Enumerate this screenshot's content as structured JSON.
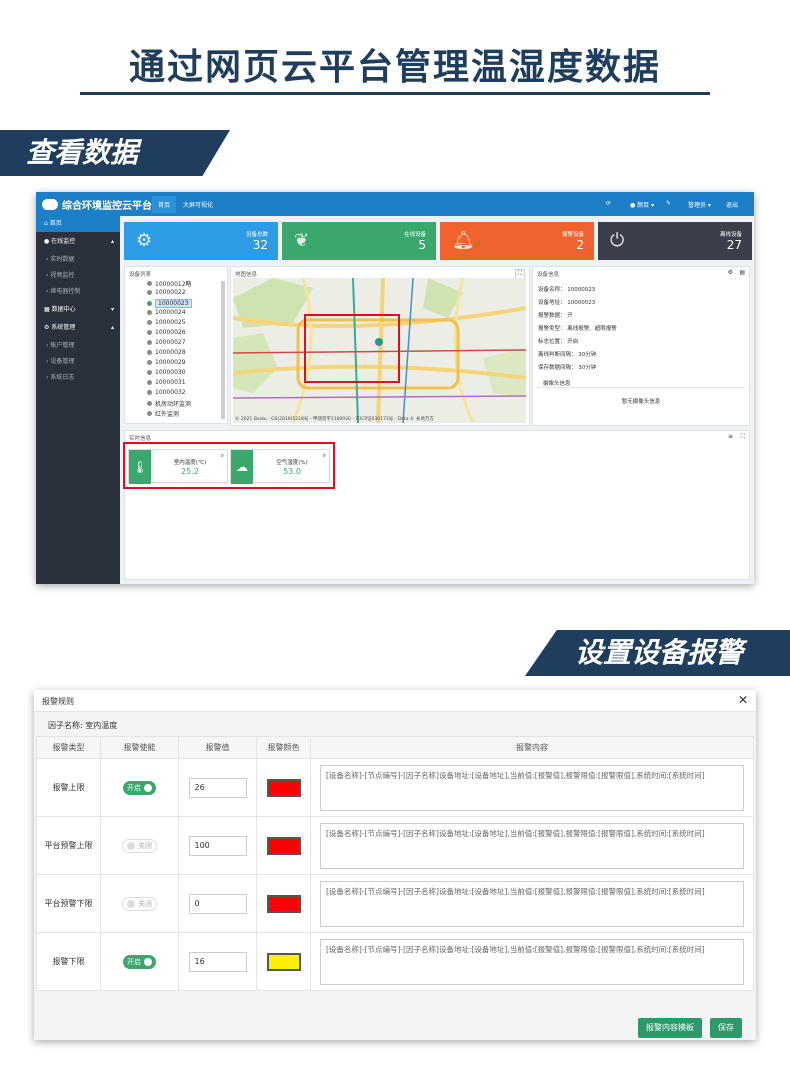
{
  "page": {
    "title": "通过网页云平台管理温湿度数据",
    "section1": "查看数据",
    "section2": "设置设备报警"
  },
  "dashboard": {
    "app_name": "综合环境监控云平台",
    "tabs": [
      "首页",
      "大屏可视化"
    ],
    "top_right": {
      "theme": "颜目",
      "admin": "管理员",
      "logout": "退出"
    },
    "sidebar": {
      "home": "首页",
      "online_monitor": "在线监控",
      "monitor_items": [
        "实时数据",
        "视频监控",
        "继电器控制"
      ],
      "data_center": "数据中心",
      "system_mgmt": "系统管理",
      "system_items": [
        "账户管理",
        "设备管理",
        "系统日志"
      ]
    },
    "stats": [
      {
        "label": "设备总数",
        "value": "32",
        "color": "#2e9be6"
      },
      {
        "label": "在线设备",
        "value": "5",
        "color": "#3aa76d"
      },
      {
        "label": "报警设备",
        "value": "2",
        "color": "#f0622e"
      },
      {
        "label": "离线设备",
        "value": "27",
        "color": "#3a3f4b"
      }
    ],
    "device_list": {
      "title": "设备列表",
      "items": [
        "10000012略",
        "10000022",
        "10000023",
        "10000024",
        "10000025",
        "10000026",
        "10000027",
        "10000028",
        "10000029",
        "10000030",
        "10000031",
        "10000032",
        "机房动环监测",
        "红外监测"
      ],
      "selected": "10000023"
    },
    "map": {
      "title": "地图信息",
      "footer": "© 2021 Baidu - GS(2019)5218号 - 甲测资字1100930 - 京ICP证030173号 - Data © 长地万方"
    },
    "device_info": {
      "title": "设备信息",
      "rows": [
        {
          "k": "设备名称：",
          "v": "10000023"
        },
        {
          "k": "设备地址：",
          "v": "10000023"
        },
        {
          "k": "报警数据：",
          "v": "开"
        },
        {
          "k": "报警类型：",
          "v": "离线报警、超限报警"
        },
        {
          "k": "标志位置：",
          "v": "开启"
        },
        {
          "k": "离线判断间隔：",
          "v": "30分钟"
        },
        {
          "k": "保存数据间隔：",
          "v": "30分钟"
        }
      ],
      "camera_title": "摄像头信息",
      "camera_empty": "暂无摄像头信息"
    },
    "realtime": {
      "title": "实时信息",
      "sensors": [
        {
          "name": "室内温度(℃)",
          "value": "25.2"
        },
        {
          "name": "空气湿度(%)",
          "value": "53.0"
        }
      ]
    }
  },
  "dialog": {
    "title": "报警规则",
    "factor_label": "因子名称:",
    "factor_value": "室内温度",
    "headers": [
      "报警类型",
      "报警使能",
      "报警值",
      "报警颜色",
      "报警内容"
    ],
    "rows": [
      {
        "type": "报警上限",
        "enabled": "开启",
        "on": true,
        "value": "26",
        "color": "#ff0000"
      },
      {
        "type": "平台预警上限",
        "enabled": "关闭",
        "on": false,
        "value": "100",
        "color": "#ff0000"
      },
      {
        "type": "平台预警下限",
        "enabled": "关闭",
        "on": false,
        "value": "0",
        "color": "#ff0000"
      },
      {
        "type": "报警下限",
        "enabled": "开启",
        "on": true,
        "value": "16",
        "color": "#ffee00"
      }
    ],
    "content_template": "[设备名称]-[节点编号]-[因子名称]设备地址:[设备地址],当前值:[报警值],报警限值:[报警限值],系统时间:[系统时间]",
    "buttons": {
      "template": "报警内容模板",
      "save": "保存"
    }
  }
}
